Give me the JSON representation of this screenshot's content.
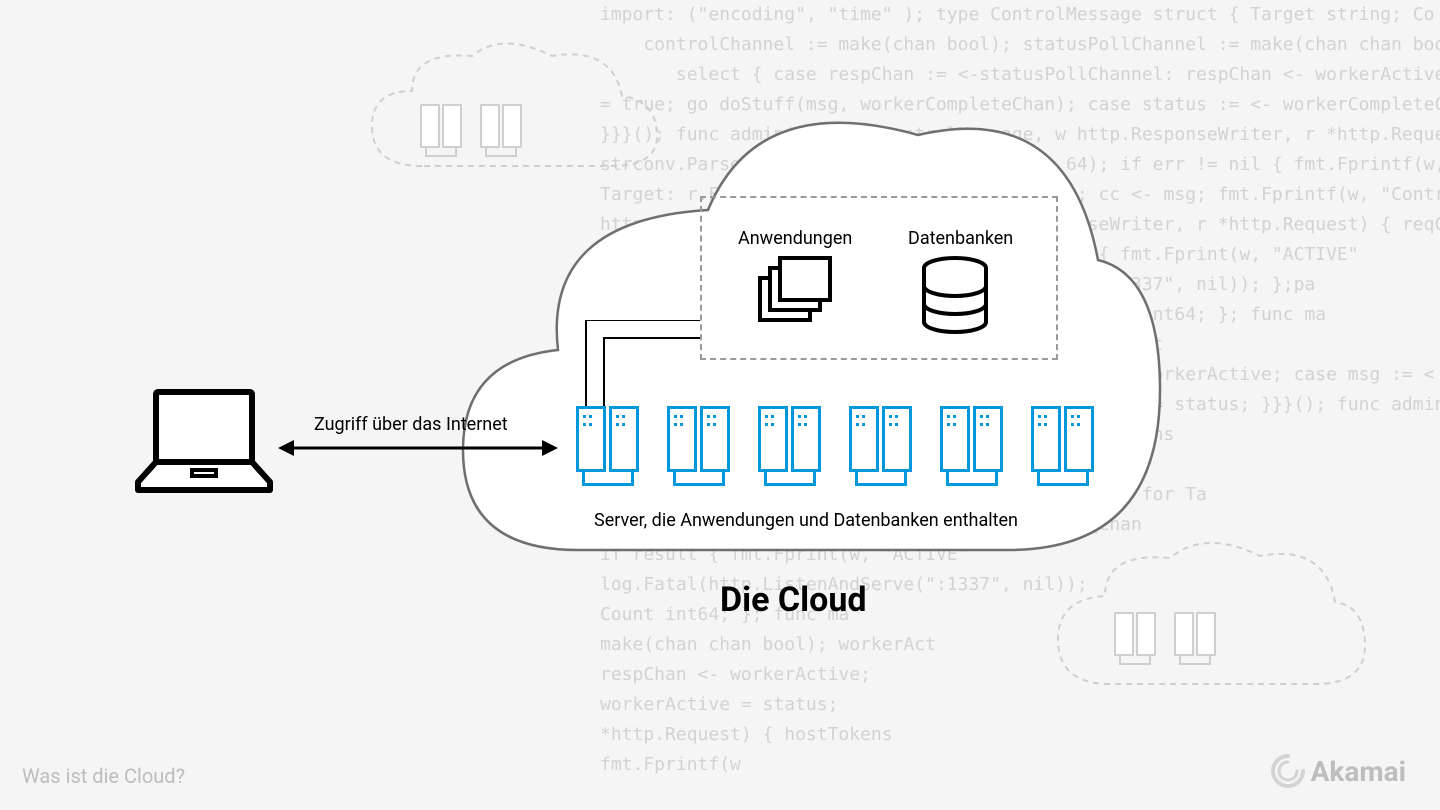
{
  "title": "Die Cloud",
  "footer_caption": "Was ist die Cloud?",
  "brand": "Akamai",
  "arrow_label": "Zugriff über das Internet",
  "apps_label": "Anwendungen",
  "db_label": "Datenbanken",
  "servers_caption": "Server, die Anwendungen und Datenbanken enthalten",
  "code_background": "import: (\"encoding\", \"time\" ); type ControlMessage struct { Target string; Co\n    controlChannel := make(chan bool); statusPollChannel := make(chan chan bool); w\n       select { case respChan := <-statusPollChannel: respChan <- workerActive; case\n= true; go doStuff(msg, workerCompleteChan); case status := <- workerCompleteChan: workerActive = status;\n}}}(); func admin(cc chan ControlMessage, w http.ResponseWriter, r *http.Request) { hostTo\nstrconv.ParseInt(r.FormValue(\"count\"), 10, 64); if err != nil { fmt.Fprintf(w,\nTarget: r.FormValue(\"target\"), Count: count}; cc <- msg; fmt.Fprintf(w, \"Control message issued for Ta\nhttp.HandleFunc(\"/status\", func(w http.ResponseWriter, r *http.Request) { reqChan\nselect { case result := <- reqChan: if result { fmt.Fprint(w, \"ACTIVE\"\n\"TIMEOUT\");}}); log.Fatal(http.ListenAndServe(\":1337\", nil)); };pa\ntype ControlMessage struct { Target string; Count int64; }; func ma\nstatusPollChannel := make(chan chan bool); workerAct\ncase respChan := <-statusPollChannel: respChan <- workerActive; case msg := <\ncase status := <- workerCompleteChan: workerActive = status; }}}(); func admin(\n(w http.ResponseWriter, r *http.Request) { hostTokens\n10, 64); if err != nil { fmt.Fprintf(w,\ncc <- msg; fmt.Fprintf(w, \"Control message issued for Ta\n(w http.ResponseWriter, r *http.Request) { reqChan\nif result { fmt.Fprint(w, \"ACTIVE\"\nlog.Fatal(http.ListenAndServe(\":1337\", nil));\nCount int64; }; func ma\nmake(chan chan bool); workerAct\nrespChan <- workerActive;\nworkerActive = status;\n*http.Request) { hostTokens\nfmt.Fprintf(w"
}
